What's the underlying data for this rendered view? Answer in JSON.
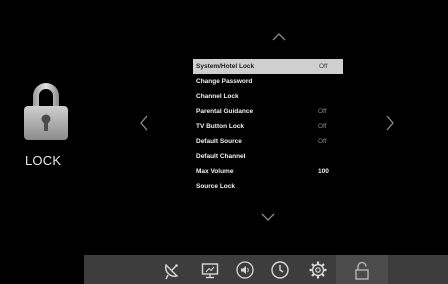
{
  "category": {
    "label": "LOCK",
    "icon": "padlock-icon"
  },
  "menu": {
    "items": [
      {
        "label": "System/Hotel Lock",
        "value": "Off",
        "selected": true
      },
      {
        "label": "Change Password",
        "value": ""
      },
      {
        "label": "Channel Lock",
        "value": ""
      },
      {
        "label": "Parental Guidance",
        "value": "Off"
      },
      {
        "label": "TV Button Lock",
        "value": "Off"
      },
      {
        "label": "Default Source",
        "value": "Off"
      },
      {
        "label": "Default Channel",
        "value": ""
      },
      {
        "label": "Max Volume",
        "value": "100"
      },
      {
        "label": "Source Lock",
        "value": ""
      }
    ]
  },
  "navigation": {
    "up": "chevron-up-icon",
    "down": "chevron-down-icon",
    "left": "chevron-left-icon",
    "right": "chevron-right-icon"
  },
  "bottom_bar": {
    "icons": [
      "satellite-dish-icon",
      "screen-icon",
      "speaker-icon",
      "clock-icon",
      "gear-icon",
      "lock-icon"
    ],
    "active": "lock-icon"
  },
  "colors": {
    "background": "#000000",
    "highlight": "#cfcfcf",
    "bar": "#3d3d3d",
    "text": "#f2f2f2",
    "dim_text": "#8a8a8a"
  }
}
